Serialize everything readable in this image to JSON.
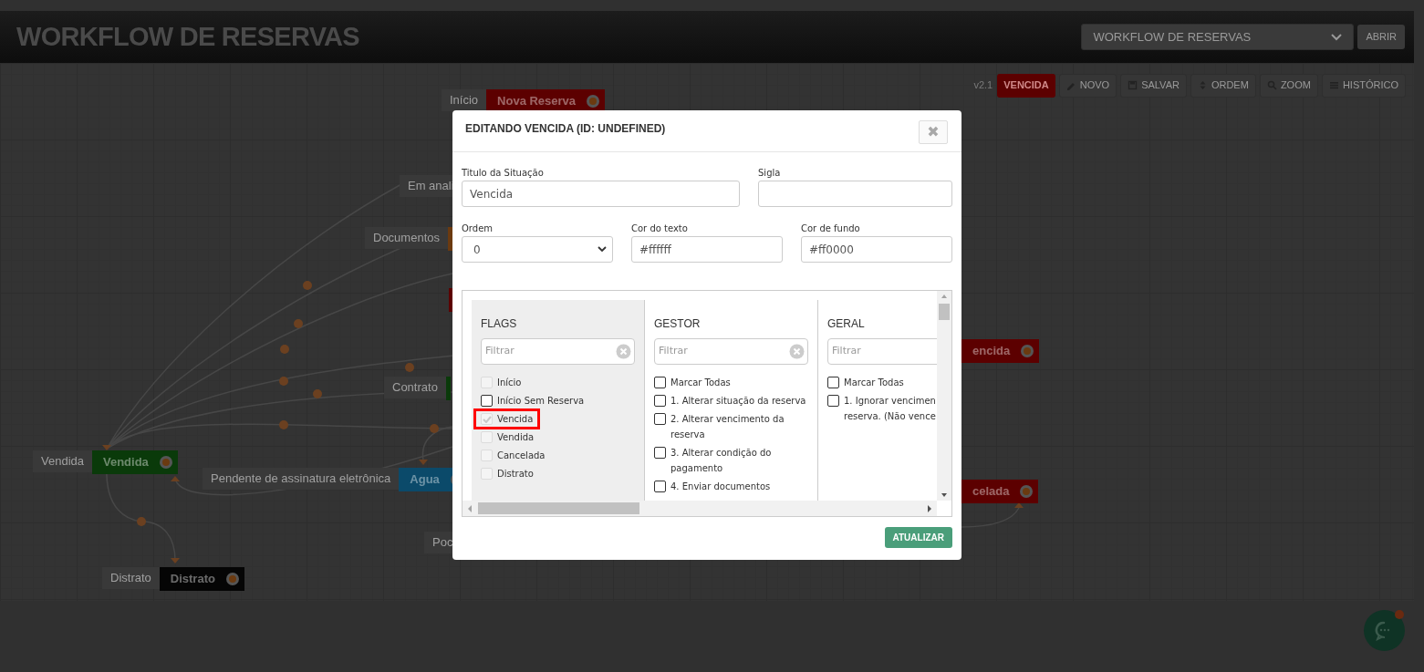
{
  "header": {
    "title": "WORKFLOW DE RESERVAS",
    "workflow_select": {
      "value": "WORKFLOW DE RESERVAS"
    },
    "open_button": "ABRIR"
  },
  "toolbar": {
    "version": "v2.1",
    "current_state": {
      "label": "VENCIDA",
      "color": "#5c0000"
    },
    "buttons": [
      {
        "label": "NOVO",
        "kind": "pencil"
      },
      {
        "label": "SALVAR",
        "kind": "save"
      },
      {
        "label": "ORDEM",
        "kind": "sort"
      },
      {
        "label": "ZOOM",
        "kind": "search"
      },
      {
        "label": "HISTÓRICO",
        "kind": "list"
      }
    ]
  },
  "canvas": {
    "nodes": [
      {
        "label": "Início",
        "title": "Nova Reserva",
        "color": "#5c0000"
      },
      {
        "label": "Em anali"
      },
      {
        "label": "Documentos",
        "color": "#6b3a10"
      },
      {
        "color": "#5c0000"
      },
      {
        "label": "Contrato",
        "color": "#0a3a0a"
      },
      {
        "label": "Vendida",
        "title": "Vendida",
        "color": "#0a3a0a"
      },
      {
        "label": "Pendente de assinatura eletrônica",
        "title": "Agua",
        "color": "#0b4a6a"
      },
      {
        "label": "Poc"
      },
      {
        "label": "Distrato",
        "title": "Distrato",
        "color": "#050505"
      },
      {
        "title": "encida",
        "color": "#5c0000"
      },
      {
        "title": "celada",
        "color": "#5c0000"
      }
    ]
  },
  "dialog": {
    "title": "EDITANDO VENCIDA (ID: UNDEFINED)",
    "close_icon": "✖",
    "fields": [
      {
        "label": "Titulo da Situação",
        "kind": "text",
        "value": "Vencida"
      },
      {
        "label": "Sigla",
        "kind": "text"
      },
      {
        "label": "Ordem",
        "kind": "select",
        "value": "0"
      },
      {
        "label": "Cor do texto",
        "kind": "text",
        "value": "#ffffff"
      },
      {
        "label": "Cor de fundo",
        "kind": "text",
        "value": "#ff0000"
      }
    ],
    "permission_columns": [
      {
        "title": "FLAGS",
        "filter_placeholder": "Filtrar",
        "items": [
          {
            "label": "Início",
            "checked": false,
            "disabled": true,
            "highlighted": false
          },
          {
            "label": "Início Sem Reserva",
            "checked": false,
            "disabled": false,
            "highlighted": false
          },
          {
            "label": "Vencida",
            "checked": true,
            "disabled": true,
            "highlighted": true
          },
          {
            "label": "Vendida",
            "checked": false,
            "disabled": true,
            "highlighted": false
          },
          {
            "label": "Cancelada",
            "checked": false,
            "disabled": true,
            "highlighted": false
          },
          {
            "label": "Distrato",
            "checked": false,
            "disabled": true,
            "highlighted": false
          }
        ]
      },
      {
        "title": "GESTOR",
        "filter_placeholder": "Filtrar",
        "items": [
          {
            "label": "Marcar Todas",
            "checked": false,
            "disabled": false,
            "highlighted": false
          },
          {
            "label": "1. Alterar situação da reserva",
            "checked": false,
            "disabled": false,
            "highlighted": false
          },
          {
            "label": "2. Alterar vencimento da reserva",
            "checked": false,
            "disabled": false,
            "highlighted": false
          },
          {
            "label": "3. Alterar condição do pagamento",
            "checked": false,
            "disabled": false,
            "highlighted": false
          },
          {
            "label": "4. Enviar documentos",
            "checked": false,
            "disabled": false,
            "highlighted": false
          }
        ]
      },
      {
        "title": "GERAL",
        "filter_placeholder": "Filtrar",
        "items": [
          {
            "label": "Marcar Todas",
            "checked": false,
            "disabled": false,
            "highlighted": false
          },
          {
            "label": "1. Ignorar vencimen\nreserva. (Não vence",
            "checked": false,
            "disabled": false,
            "highlighted": false
          }
        ]
      }
    ],
    "submit_button": "ATUALIZAR"
  }
}
